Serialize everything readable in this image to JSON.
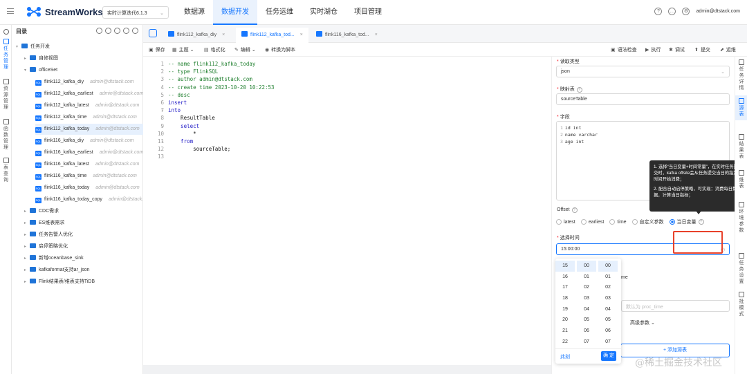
{
  "brand": {
    "name": "StreamWorks"
  },
  "project": {
    "label": "实时计算迭代6.1.3"
  },
  "nav": [
    "数据源",
    "数据开发",
    "任务运维",
    "实时湖仓",
    "项目管理"
  ],
  "user": "admin@dtstack.com",
  "left_rail": [
    "任务管理",
    "资源管理",
    "函数管理",
    "表查询"
  ],
  "tree": {
    "title": "目录",
    "root": "任务开发",
    "self_view": "自修视图",
    "officeset": "officeSet",
    "items": [
      {
        "name": "flink112_kafka_diy",
        "owner": "admin@dtstack.com"
      },
      {
        "name": "flink112_kafka_earliest",
        "owner": "admin@dtstack.com"
      },
      {
        "name": "flink112_kafka_latest",
        "owner": "admin@dtstack.com"
      },
      {
        "name": "flink112_kafka_time",
        "owner": "admin@dtstack.com"
      },
      {
        "name": "flink112_kafka_today",
        "owner": "admin@dtstack.com"
      },
      {
        "name": "flink116_kafka_diy",
        "owner": "admin@dtstack.com"
      },
      {
        "name": "flink116_kafka_earliest",
        "owner": "admin@dtstack.com"
      },
      {
        "name": "flink116_kafka_latest",
        "owner": "admin@dtstack.com"
      },
      {
        "name": "flink116_kafka_time",
        "owner": "admin@dtstack.com"
      },
      {
        "name": "flink116_kafka_today",
        "owner": "admin@dtstack.com"
      },
      {
        "name": "flink116_kafka_today_copy",
        "owner": "admin@dtstack.com"
      }
    ],
    "folders": [
      "CDC需求",
      "ES维表需求",
      "任务告警人优化",
      "启停策略优化",
      "新增oceanbase_sink",
      "kafkaformat支持ar_json",
      "Flink结果表/维表支持TiDB"
    ]
  },
  "tabs": [
    "flink112_kafka_diy",
    "flink112_kafka_tod...",
    "flink116_kafka_tod..."
  ],
  "toolbar": {
    "left": [
      "保存",
      "主题",
      "格式化",
      "编辑",
      "转换为脚本"
    ],
    "right": [
      "语法检查",
      "执行",
      "调试",
      "提交",
      "运维"
    ]
  },
  "code": [
    "-- name flink112_kafka_today",
    "-- type FlinkSQL",
    "-- author admin@dtstack.com",
    "-- create time 2023-10-20 10:22:53",
    "-- desc",
    "insert",
    "into",
    "    ResultTable",
    "    select",
    "        *",
    "    from",
    "        sourceTable;",
    ""
  ],
  "panel": {
    "read_type_label": "读取类型",
    "read_type_value": "json",
    "mapping_label": "映射表",
    "mapping_value": "sourceTable",
    "fields_label": "字段",
    "fields": [
      "id int",
      "name varchar",
      "age int"
    ],
    "offset_label": "Offset",
    "offset_options": [
      "latest",
      "earliest",
      "time",
      "自定义参数",
      "当日变量"
    ],
    "offset_selected": "当日变量",
    "time_label": "选择时间",
    "time_value": "15:00:00",
    "partial_me": "me",
    "partial_proc": "默认为 proc_time",
    "advanced": "高级参数",
    "add_source": "添加源表"
  },
  "tooltip": {
    "line1": "1. 选择“当日变量+时间常量”，在实时任务提交时，kafka offsite会从任务提交当日的指定时间开始消费；",
    "line2": "2. 配合自动启停策略，可实现：消费每日数据，计算当日指标；"
  },
  "picker": {
    "hours": [
      "15",
      "16",
      "17",
      "18",
      "19",
      "20",
      "21",
      "22"
    ],
    "minutes": [
      "00",
      "01",
      "02",
      "03",
      "04",
      "05",
      "06",
      "07"
    ],
    "seconds": [
      "00",
      "01",
      "02",
      "03",
      "04",
      "05",
      "06",
      "07"
    ],
    "now": "此刻",
    "ok": "确 定"
  },
  "right_rail": [
    "任务详情",
    "源表",
    "结果表",
    "维表",
    "环境参数",
    "任务设置",
    "批模式"
  ],
  "watermark": "@稀土掘金技术社区"
}
